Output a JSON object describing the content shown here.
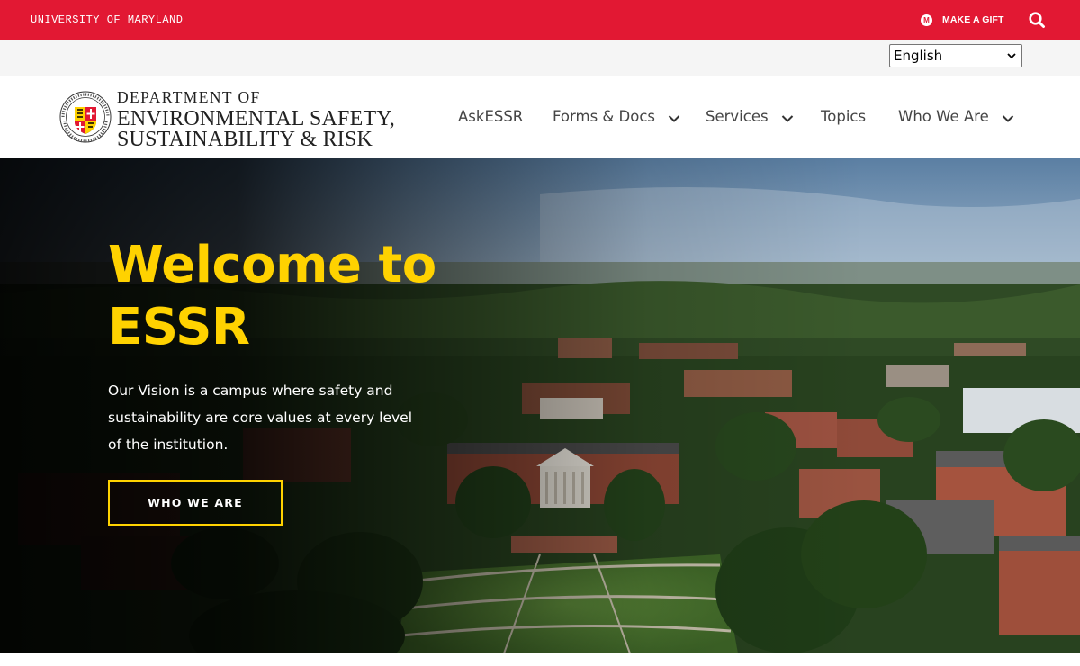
{
  "top_bar": {
    "university_label": "UNIVERSITY OF MARYLAND",
    "gift_icon_glyph": "M",
    "gift_label": "MAKE A GIFT",
    "icons": [
      "umd-m-icon",
      "search-icon"
    ],
    "color": "#e21833"
  },
  "language": {
    "selected": "English"
  },
  "header": {
    "dept_line1": "DEPARTMENT OF",
    "dept_line2": "ENVIRONMENTAL SAFETY,",
    "dept_line3": "SUSTAINABILITY & RISK",
    "logo_icon": "umd-seal-icon",
    "nav": [
      {
        "label": "AskESSR",
        "has_dropdown": false
      },
      {
        "label": "Forms & Docs",
        "has_dropdown": true
      },
      {
        "label": "Services",
        "has_dropdown": true
      },
      {
        "label": "Topics",
        "has_dropdown": false
      },
      {
        "label": "Who We Are",
        "has_dropdown": true
      }
    ]
  },
  "hero": {
    "title": "Welcome to ESSR",
    "text": "Our Vision is a campus where safety and sustainability are core values at every level of the institution.",
    "button_label": "WHO WE ARE",
    "accent_color": "#ffd200"
  }
}
